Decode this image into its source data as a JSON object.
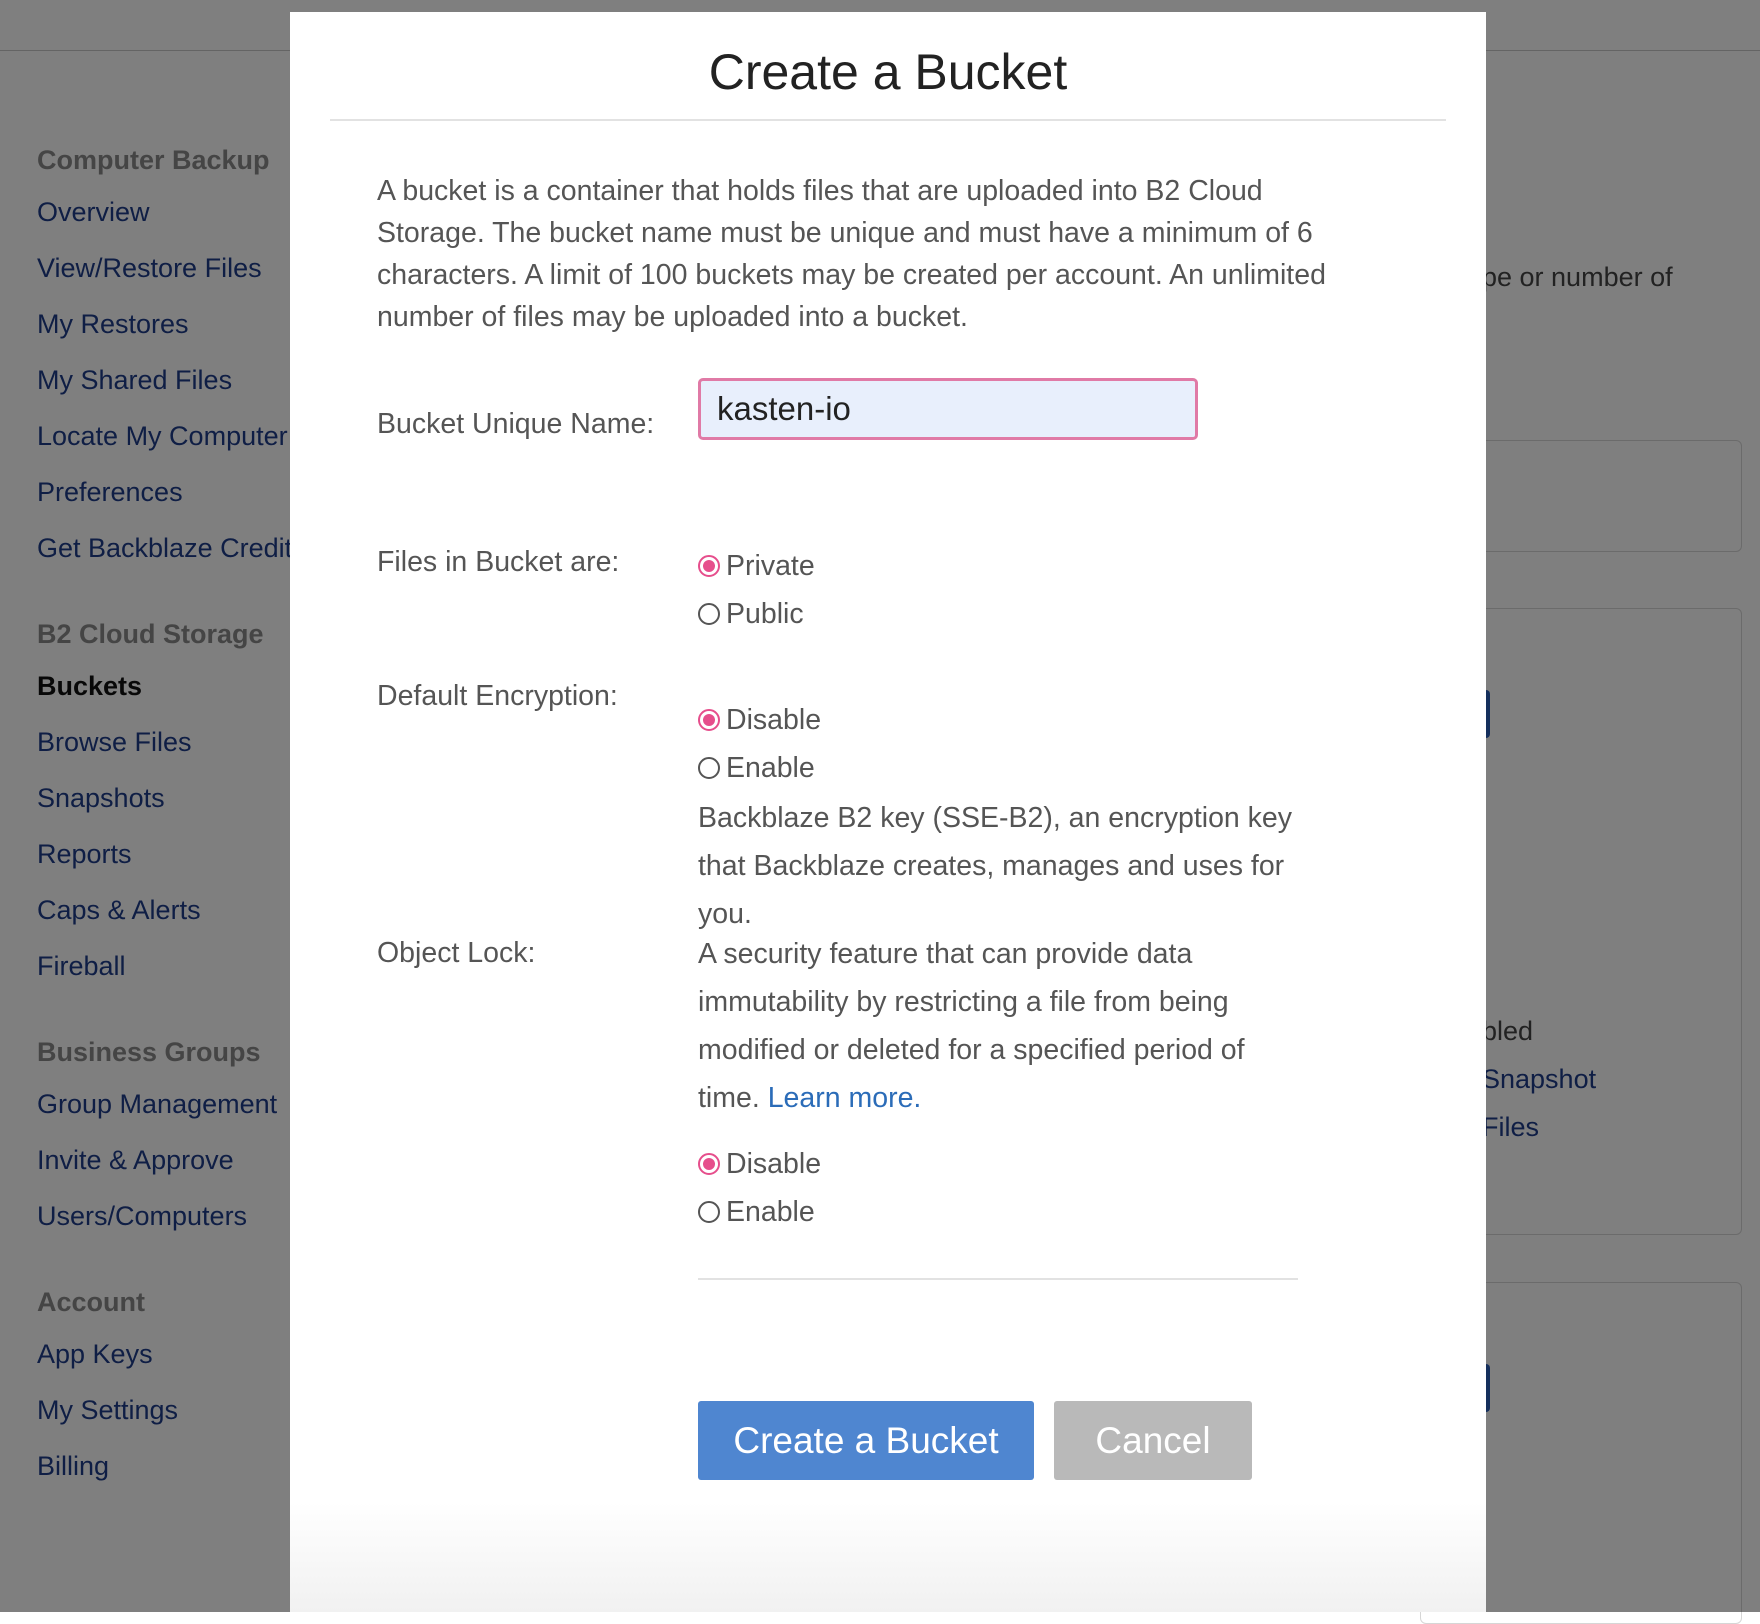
{
  "sidebar": {
    "sections": [
      {
        "heading": "Computer Backup",
        "items": [
          "Overview",
          "View/Restore Files",
          "My Restores",
          "My Shared Files",
          "Locate My Computer",
          "Preferences",
          "Get Backblaze Credit"
        ]
      },
      {
        "heading": "B2 Cloud Storage",
        "items": [
          "Buckets",
          "Browse Files",
          "Snapshots",
          "Reports",
          "Caps & Alerts",
          "Fireball"
        ],
        "active": "Buckets"
      },
      {
        "heading": "Business Groups",
        "items": [
          "Group Management",
          "Invite & Approve",
          "Users/Computers"
        ]
      },
      {
        "heading": "Account",
        "items": [
          "App Keys",
          "My Settings",
          "Billing"
        ]
      }
    ]
  },
  "background": {
    "partial_text_1": "pe or number of",
    "partial_text_2": "bled",
    "partial_link_1": "Snapshot",
    "partial_link_2": "Files"
  },
  "modal": {
    "title": "Create a Bucket",
    "description": "A bucket is a container that holds files that are uploaded into B2 Cloud Storage. The bucket name must be unique and must have a minimum of 6 characters. A limit of 100 buckets may be created per account. An unlimited number of files may be uploaded into a bucket.",
    "name_label": "Bucket Unique Name:",
    "name_value": "kasten-io",
    "visibility": {
      "label": "Files in Bucket are:",
      "options": [
        "Private",
        "Public"
      ],
      "selected": "Private"
    },
    "encryption": {
      "label": "Default Encryption:",
      "options": [
        "Disable",
        "Enable"
      ],
      "selected": "Disable",
      "help": "Backblaze B2 key (SSE-B2), an encryption key that Backblaze creates, manages and uses for you."
    },
    "object_lock": {
      "label": "Object Lock:",
      "help": "A security feature that can provide data immutability by restricting a file from being modified or deleted for a specified period of time.",
      "learn_more": "Learn more.",
      "options": [
        "Disable",
        "Enable"
      ],
      "selected": "Disable"
    },
    "create_button": "Create a Bucket",
    "cancel_button": "Cancel"
  },
  "colors": {
    "accent_pink": "#e64e8c",
    "primary_button": "#4f86d0",
    "cancel_button": "#b9b9b9",
    "nav_link": "#1f3d8a",
    "link": "#2b6cb8"
  }
}
